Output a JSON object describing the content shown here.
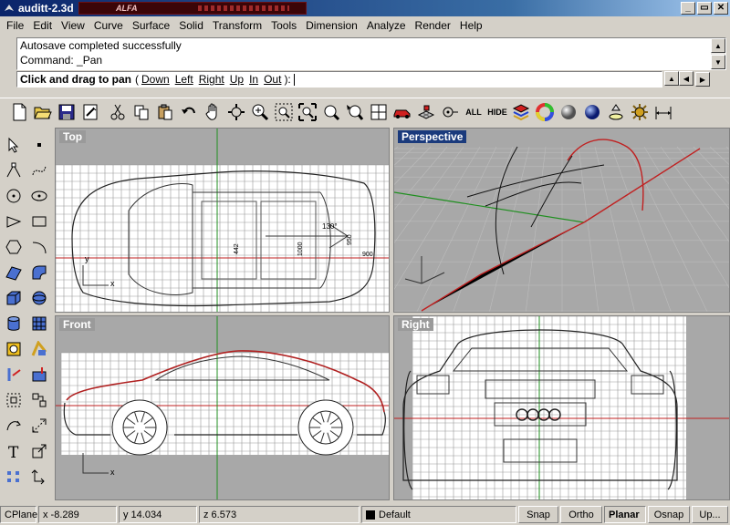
{
  "window": {
    "title": "auditt-2.3d",
    "skin_label": "ALFA",
    "buttons": [
      "_",
      "▭",
      "✕"
    ]
  },
  "menu": [
    "File",
    "Edit",
    "View",
    "Curve",
    "Surface",
    "Solid",
    "Transform",
    "Tools",
    "Dimension",
    "Analyze",
    "Render",
    "Help"
  ],
  "command": {
    "history": [
      "Autosave completed successfully",
      "Command: _Pan"
    ],
    "prompt": "Click and drag to pan",
    "open_paren": "(",
    "options": [
      "Down",
      "Left",
      "Right",
      "Up",
      "In",
      "Out"
    ],
    "close_paren": "):"
  },
  "toolbar": {
    "icons": [
      "new-icon",
      "open-icon",
      "save-icon",
      "print-icon",
      "cut-icon",
      "copy-icon",
      "paste-icon",
      "undo-icon",
      "pan-icon",
      "rotate-view-icon",
      "zoom-dynamic-icon",
      "zoom-window-icon",
      "zoom-extents-icon",
      "zoom-selected-icon",
      "undo-view-icon",
      "four-viewports-icon",
      "car-icon",
      "grid-cube-icon",
      "cplane-icon",
      "show-all-icon",
      "hide-icon",
      "layers-icon",
      "color-wheel-icon",
      "render-sphere-icon",
      "blue-sphere-icon",
      "light-icon",
      "options-gear-icon",
      "dimension-icon"
    ],
    "text_labels": {
      "all": "ALL",
      "hide": "HIDE"
    }
  },
  "palette": [
    "select-icon",
    "point-icon",
    "polyline-icon",
    "curve-icon",
    "circle-icon",
    "ellipse-icon",
    "polygon-icon",
    "rectangle-icon",
    "hexagon-icon",
    "arc-icon",
    "surface-icon",
    "fillet-icon",
    "box-icon",
    "sphere-icon",
    "cylinder-icon",
    "mesh-icon",
    "group-icon",
    "boolean-icon",
    "trim-icon",
    "extend-icon",
    "split-icon",
    "join-icon",
    "array-icon",
    "move-icon",
    "text-icon",
    "scale-icon",
    "points-on-icon",
    "transform-icon"
  ],
  "viewports": [
    {
      "name": "Top",
      "active": false
    },
    {
      "name": "Perspective",
      "active": true
    },
    {
      "name": "Front",
      "active": false
    },
    {
      "name": "Right",
      "active": false
    }
  ],
  "dimensions": {
    "angle": "130°",
    "d1": "900",
    "d2": "950",
    "d3": "1000",
    "d4": "442"
  },
  "status": {
    "cplane": "CPlane",
    "x": "x -8.289",
    "y": "y 14.034",
    "z": "z 6.573",
    "layer": "Default",
    "snap": "Snap",
    "ortho": "Ortho",
    "planar": "Planar",
    "osnap": "Osnap",
    "up": "Up..."
  },
  "colors": {
    "active_title": "#1a3a7c",
    "axis_x": "#c02020",
    "axis_y": "#1f8f1f",
    "viewport_bg": "#a8a8a8",
    "grid_bg": "#ffffff"
  }
}
